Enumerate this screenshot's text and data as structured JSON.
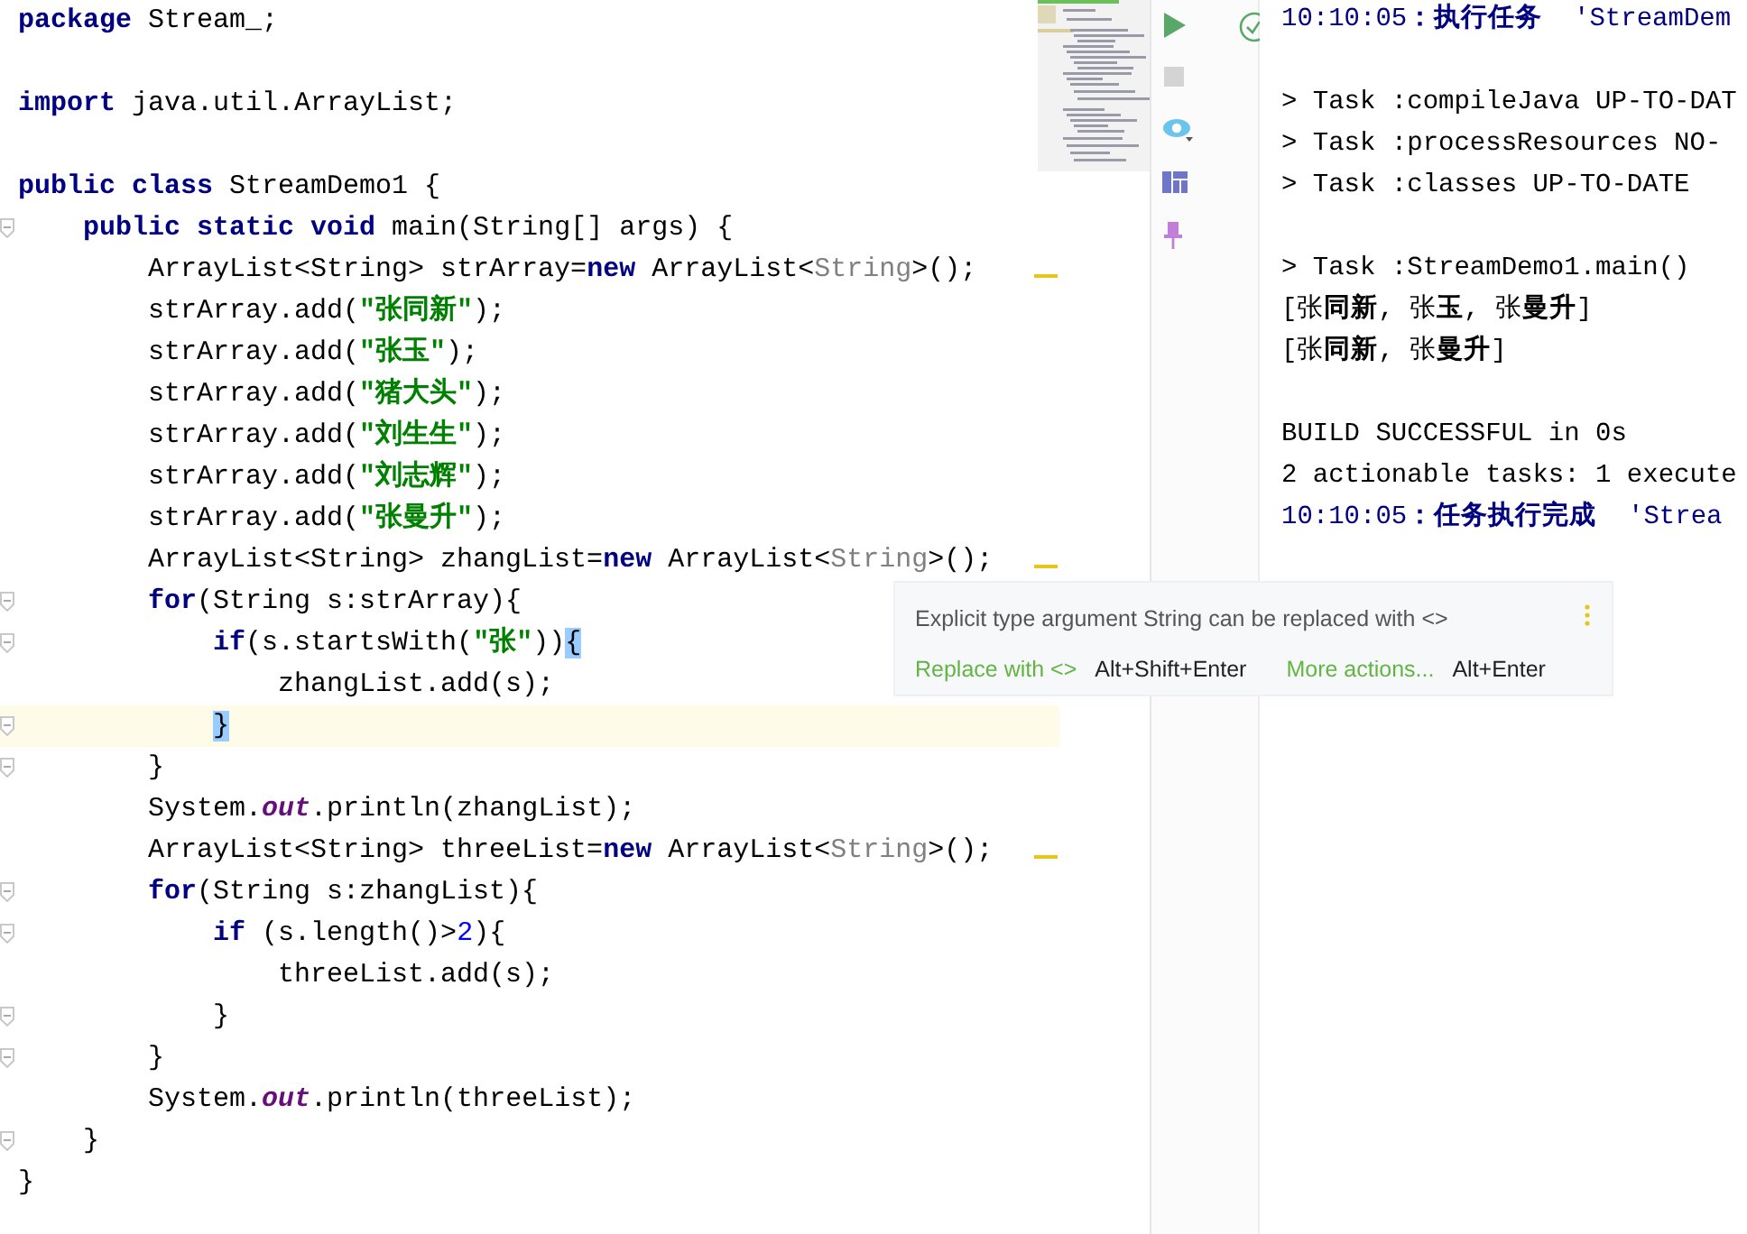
{
  "editor": {
    "lines": [
      {
        "fold": false,
        "warning": false,
        "highlighted": false,
        "tokens": [
          {
            "kind": "kw",
            "text": "package"
          },
          {
            "kind": "plain",
            "text": " Stream_;"
          }
        ]
      },
      {
        "fold": false,
        "warning": false,
        "highlighted": false
      },
      {
        "fold": false,
        "warning": false,
        "highlighted": false,
        "tokens": [
          {
            "kind": "kw",
            "text": "import"
          },
          {
            "kind": "plain",
            "text": " java.util.ArrayList;"
          }
        ]
      },
      {
        "fold": false,
        "warning": false,
        "highlighted": false
      },
      {
        "fold": false,
        "warning": false,
        "highlighted": false,
        "tokens": [
          {
            "kind": "kw",
            "text": "public class"
          },
          {
            "kind": "plain",
            "text": " StreamDemo1 {"
          }
        ]
      },
      {
        "fold": true,
        "warning": false,
        "highlighted": false,
        "tokens": [
          {
            "kind": "kw",
            "text": "    public static void"
          },
          {
            "kind": "plain",
            "text": " main(String[] args) {"
          }
        ]
      },
      {
        "fold": false,
        "warning": true,
        "highlighted": false,
        "tokens": [
          {
            "kind": "plain",
            "text": "        ArrayList<String> strArray="
          },
          {
            "kind": "kw",
            "text": "new"
          },
          {
            "kind": "plain",
            "text": " ArrayList<"
          },
          {
            "kind": "gray",
            "text": "String"
          },
          {
            "kind": "plain",
            "text": ">();"
          }
        ]
      },
      {
        "fold": false,
        "warning": false,
        "highlighted": false,
        "tokens": [
          {
            "kind": "plain",
            "text": "        strArray.add("
          },
          {
            "kind": "str",
            "text": "\"张同新\""
          },
          {
            "kind": "plain",
            "text": ");"
          }
        ]
      },
      {
        "fold": false,
        "warning": false,
        "highlighted": false,
        "tokens": [
          {
            "kind": "plain",
            "text": "        strArray.add("
          },
          {
            "kind": "str",
            "text": "\"张玉\""
          },
          {
            "kind": "plain",
            "text": ");"
          }
        ]
      },
      {
        "fold": false,
        "warning": false,
        "highlighted": false,
        "tokens": [
          {
            "kind": "plain",
            "text": "        strArray.add("
          },
          {
            "kind": "str",
            "text": "\"猪大头\""
          },
          {
            "kind": "plain",
            "text": ");"
          }
        ]
      },
      {
        "fold": false,
        "warning": false,
        "highlighted": false,
        "tokens": [
          {
            "kind": "plain",
            "text": "        strArray.add("
          },
          {
            "kind": "str",
            "text": "\"刘生生\""
          },
          {
            "kind": "plain",
            "text": ");"
          }
        ]
      },
      {
        "fold": false,
        "warning": false,
        "highlighted": false,
        "tokens": [
          {
            "kind": "plain",
            "text": "        strArray.add("
          },
          {
            "kind": "str",
            "text": "\"刘志辉\""
          },
          {
            "kind": "plain",
            "text": ");"
          }
        ]
      },
      {
        "fold": false,
        "warning": false,
        "highlighted": false,
        "tokens": [
          {
            "kind": "plain",
            "text": "        strArray.add("
          },
          {
            "kind": "str",
            "text": "\"张曼升\""
          },
          {
            "kind": "plain",
            "text": ");"
          }
        ]
      },
      {
        "fold": false,
        "warning": true,
        "highlighted": false,
        "tokens": [
          {
            "kind": "plain",
            "text": "        ArrayList<String> zhangList="
          },
          {
            "kind": "kw",
            "text": "new"
          },
          {
            "kind": "plain",
            "text": " ArrayList<"
          },
          {
            "kind": "gray",
            "text": "String"
          },
          {
            "kind": "plain",
            "text": ">();"
          }
        ]
      },
      {
        "fold": true,
        "warning": false,
        "highlighted": false,
        "tokens": [
          {
            "kind": "kw",
            "text": "        for"
          },
          {
            "kind": "plain",
            "text": "(String s:strArray){"
          }
        ]
      },
      {
        "fold": true,
        "warning": false,
        "highlighted": false,
        "tokens": [
          {
            "kind": "kw",
            "text": "            if"
          },
          {
            "kind": "plain",
            "text": "(s.startsWith("
          },
          {
            "kind": "str",
            "text": "\"张\""
          },
          {
            "kind": "plain",
            "text": "))"
          },
          {
            "kind": "brace",
            "text": "{"
          }
        ]
      },
      {
        "fold": false,
        "warning": false,
        "highlighted": false,
        "tokens": [
          {
            "kind": "plain",
            "text": "                zhangList.add(s);"
          }
        ]
      },
      {
        "fold": true,
        "warning": false,
        "highlighted": true,
        "tokens": [
          {
            "kind": "brace",
            "text": "            }"
          }
        ]
      },
      {
        "fold": true,
        "warning": false,
        "highlighted": false,
        "tokens": [
          {
            "kind": "plain",
            "text": "        }"
          }
        ]
      },
      {
        "fold": false,
        "warning": false,
        "highlighted": false,
        "tokens": [
          {
            "kind": "plain",
            "text": "        System."
          },
          {
            "kind": "field",
            "text": "out"
          },
          {
            "kind": "plain",
            "text": ".println(zhangList);"
          }
        ]
      },
      {
        "fold": false,
        "warning": true,
        "highlighted": false,
        "tokens": [
          {
            "kind": "plain",
            "text": "        ArrayList<String> threeList="
          },
          {
            "kind": "kw",
            "text": "new"
          },
          {
            "kind": "plain",
            "text": " ArrayList<"
          },
          {
            "kind": "gray",
            "text": "String"
          },
          {
            "kind": "plain",
            "text": ">();"
          }
        ]
      },
      {
        "fold": true,
        "warning": false,
        "highlighted": false,
        "tokens": [
          {
            "kind": "kw",
            "text": "        for"
          },
          {
            "kind": "plain",
            "text": "(String s:zhangList){"
          }
        ]
      },
      {
        "fold": true,
        "warning": false,
        "highlighted": false,
        "tokens": [
          {
            "kind": "kw",
            "text": "            if"
          },
          {
            "kind": "plain",
            "text": " (s.length()>"
          },
          {
            "kind": "num",
            "text": "2"
          },
          {
            "kind": "plain",
            "text": "){"
          }
        ]
      },
      {
        "fold": false,
        "warning": false,
        "highlighted": false,
        "tokens": [
          {
            "kind": "plain",
            "text": "                threeList.add(s);"
          }
        ]
      },
      {
        "fold": true,
        "warning": false,
        "highlighted": false,
        "tokens": [
          {
            "kind": "plain",
            "text": "            }"
          }
        ]
      },
      {
        "fold": true,
        "warning": false,
        "highlighted": false,
        "tokens": [
          {
            "kind": "plain",
            "text": "        }"
          }
        ]
      },
      {
        "fold": false,
        "warning": false,
        "highlighted": false,
        "tokens": [
          {
            "kind": "plain",
            "text": "        System."
          },
          {
            "kind": "field",
            "text": "out"
          },
          {
            "kind": "plain",
            "text": ".println(threeList);"
          }
        ]
      },
      {
        "fold": true,
        "warning": false,
        "highlighted": false,
        "tokens": [
          {
            "kind": "plain",
            "text": "    }"
          }
        ]
      },
      {
        "fold": false,
        "warning": false,
        "highlighted": false,
        "tokens": [
          {
            "kind": "plain",
            "text": "}"
          }
        ]
      }
    ]
  },
  "intention_popup": {
    "message": "Explicit type argument String can be replaced with <>",
    "actions": [
      {
        "label": "Replace with <>",
        "shortcut": "Alt+Shift+Enter"
      },
      {
        "label": "More actions...",
        "shortcut": "Alt+Enter"
      }
    ]
  },
  "console": {
    "lines": [
      {
        "kind": "status",
        "text": "10:10:05**：执行任务**  'StreamDem"
      },
      {
        "kind": "blank"
      },
      {
        "kind": "output",
        "text": "> Task :compileJava UP-TO-DAT"
      },
      {
        "kind": "output",
        "text": "> Task :processResources NO-"
      },
      {
        "kind": "output",
        "text": "> Task :classes UP-TO-DATE"
      },
      {
        "kind": "blank"
      },
      {
        "kind": "output",
        "text": "> Task :StreamDemo1.main()"
      },
      {
        "kind": "output",
        "text": "[张**同新**, 张**玉**, 张**曼升**]"
      },
      {
        "kind": "output",
        "text": "[张**同新**, 张**曼升**]"
      },
      {
        "kind": "blank"
      },
      {
        "kind": "output",
        "text": "BUILD SUCCESSFUL in 0s"
      },
      {
        "kind": "output",
        "text": "2 actionable tasks: 1 execute"
      },
      {
        "kind": "status",
        "text": "10:10:05**：任务执行完成**  'Strea"
      }
    ]
  }
}
